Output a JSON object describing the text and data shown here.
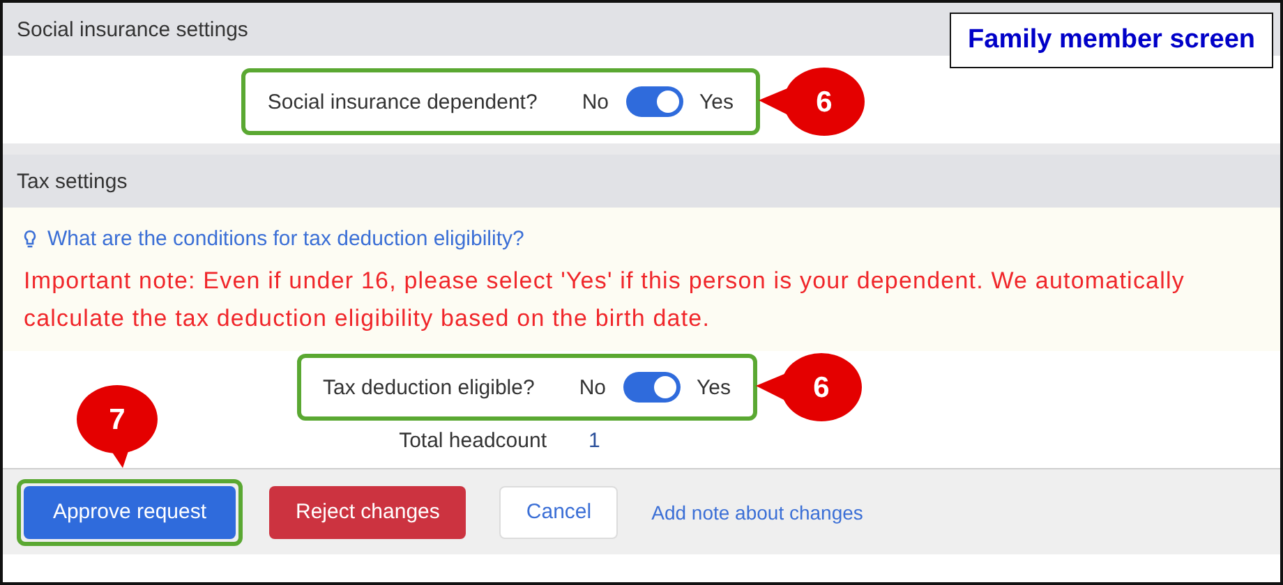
{
  "annotation_label": "Family member screen",
  "social_insurance": {
    "title": "Social insurance settings",
    "toggle": {
      "label": "Social insurance dependent?",
      "off_label": "No",
      "on_label": "Yes",
      "on": true,
      "highlighted": true,
      "callout": "6"
    }
  },
  "tax": {
    "title": "Tax settings",
    "hint_link": "What are the conditions for tax deduction eligibility?",
    "note": "Important note: Even if under 16, please select 'Yes' if this person is your dependent. We automatically calculate the tax deduction eligibility based on the birth date.",
    "toggle": {
      "label": "Tax deduction eligible?",
      "off_label": "No",
      "on_label": "Yes",
      "on": true,
      "highlighted": true,
      "callout": "6"
    },
    "headcount": {
      "label": "Total headcount",
      "value": "1"
    }
  },
  "footer": {
    "buttons": [
      {
        "label": "Approve request",
        "kind": "primary",
        "highlighted": true,
        "callout": "7"
      },
      {
        "label": "Reject changes",
        "kind": "danger",
        "highlighted": false
      },
      {
        "label": "Cancel",
        "kind": "secondary",
        "highlighted": false
      },
      {
        "label": "Add note about changes",
        "kind": "link",
        "highlighted": false
      }
    ]
  }
}
